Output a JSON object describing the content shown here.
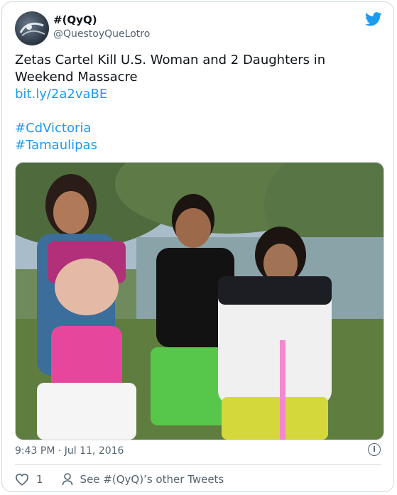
{
  "author": {
    "name": "#(QyQ)",
    "handle": "@QuestoyQueLotro"
  },
  "tweet": {
    "text_line1": "Zetas Cartel Kill U.S. Woman and 2 Daughters in",
    "text_line2": "Weekend Massacre",
    "link": "bit.ly/2a2vaBE",
    "hashtag1": "#CdVictoria",
    "hashtag2": "#Tamaulipas"
  },
  "meta": {
    "timestamp": "9:43 PM · Jul 11, 2016",
    "info_icon": "i"
  },
  "actions": {
    "like_count": "1",
    "profile_link": "See #(QyQ)’s other Tweets"
  },
  "icons": {
    "brand": "twitter-bird-icon",
    "like": "heart-icon",
    "profile": "person-icon",
    "info": "info-icon"
  },
  "colors": {
    "accent": "#1d9bf0",
    "secondary_text": "#536471",
    "border": "#cfd9de"
  }
}
